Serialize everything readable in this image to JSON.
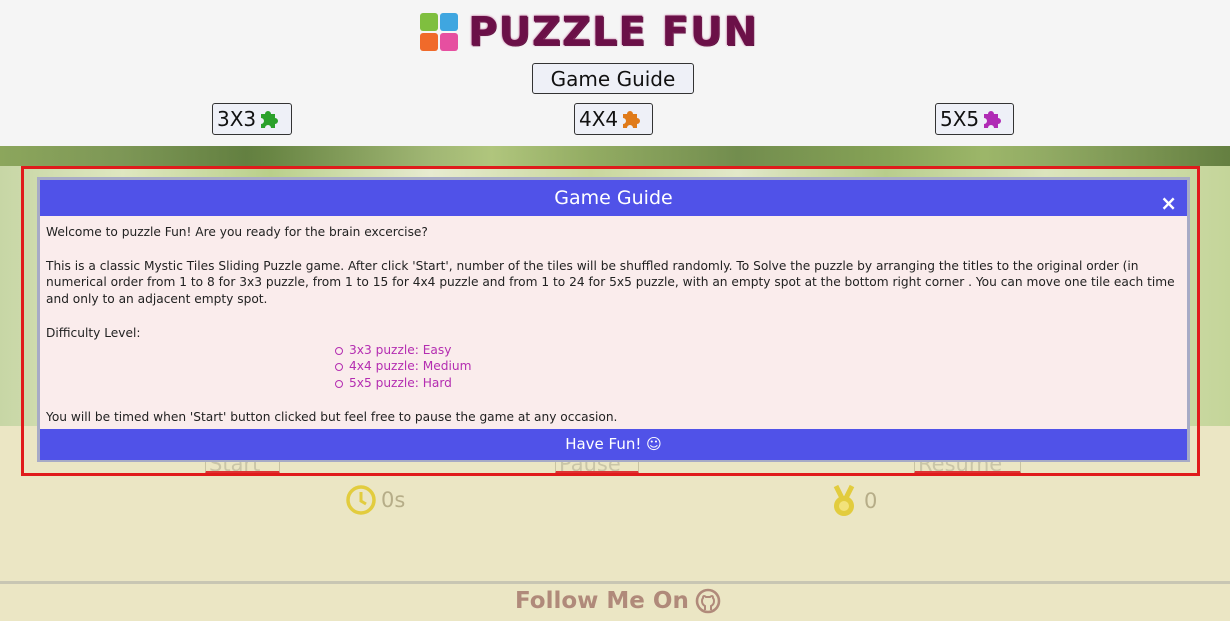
{
  "header": {
    "title": "PUZZLE FUN",
    "guide_button": "Game Guide",
    "sizes": [
      {
        "label": "3X3",
        "icon": "puzzle-piece-icon",
        "color": "#2ba12b"
      },
      {
        "label": "4X4",
        "icon": "puzzle-piece-icon",
        "color": "#e07b1a"
      },
      {
        "label": "5X5",
        "icon": "puzzle-piece-icon",
        "color": "#b02bb5"
      }
    ]
  },
  "controls": {
    "start": "Start",
    "pause": "Pause",
    "resume": "Resume",
    "timer": "0s",
    "moves": "0"
  },
  "footer": {
    "follow": "Follow Me On"
  },
  "modal": {
    "title": "Game Guide",
    "close": "×",
    "welcome": "Welcome to puzzle Fun! Are you ready for the brain excercise?",
    "description": "This is a classic Mystic Tiles Sliding Puzzle game. After click 'Start', number of the tiles will be shuffled randomly. To Solve the puzzle by arranging the titles to the original order (in numerical order from 1 to 8 for 3x3 puzzle, from 1 to 15 for 4x4 puzzle and from 1 to 24 for 5x5 puzzle, with an empty spot at the bottom right corner . You can move one tile each time and only to an adjacent empty spot.",
    "difficulty_label": "Difficulty Level:",
    "levels": [
      "3x3 puzzle: Easy",
      "4x4 puzzle: Medium",
      "5x5 puzzle: Hard"
    ],
    "timing": "You will be timed when 'Start' button clicked but feel free to pause the game at any occasion.",
    "footer": "Have Fun! ☺"
  },
  "colors": {
    "modal_header": "#5052e8",
    "modal_body": "#faecec",
    "level_text": "#b42db1",
    "highlight": "#e01b1b",
    "brand": "#6b1048"
  }
}
